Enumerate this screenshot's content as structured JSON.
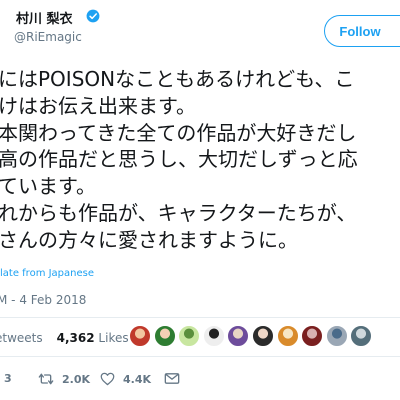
{
  "author": {
    "name": "村川 梨衣",
    "handle": "@RiEmagic",
    "verified": true
  },
  "follow_button": {
    "label": "Follow"
  },
  "tweet": {
    "lines": [
      "にはPOISONなこともあるけれども、こ",
      "けはお伝え出来ます。",
      "本関わってきた全ての作品が大好きだし",
      "高の作品だと思うし、大切だしずっと応",
      "ています。",
      "れからも作品が、キャラクターたちが、",
      "さんの方々に愛されますように。"
    ]
  },
  "translate_link": "late from Japanese",
  "timestamp": "M - 4 Feb 2018",
  "stats": {
    "retweets_label": "etweets",
    "likes_count": "4,362",
    "likes_label": "Likes"
  },
  "liker_avatars": [
    {
      "name": "avatar-1",
      "color": "#c0392b",
      "accent": "#f2c6a0"
    },
    {
      "name": "avatar-2",
      "color": "#2e7d32",
      "accent": "#f5d0b5"
    },
    {
      "name": "avatar-3",
      "color": "#c8e6a0",
      "accent": "#5a8f3c"
    },
    {
      "name": "avatar-4",
      "color": "#eeeeee",
      "accent": "#222222"
    },
    {
      "name": "avatar-5",
      "color": "#6d4c9b",
      "accent": "#e8d5c4"
    },
    {
      "name": "avatar-6",
      "color": "#2b2b2b",
      "accent": "#f0d8c8"
    },
    {
      "name": "avatar-7",
      "color": "#d98b2b",
      "accent": "#f7e6c4"
    },
    {
      "name": "avatar-8",
      "color": "#7a1f1f",
      "accent": "#d8b0b0"
    },
    {
      "name": "avatar-9",
      "color": "#9aa7b5",
      "accent": "#4a6b8a"
    },
    {
      "name": "avatar-10",
      "color": "#546e7a",
      "accent": "#cfd8dc"
    }
  ],
  "actions": {
    "reply_count": "3",
    "retweet_count": "2.0K",
    "like_count": "4.4K"
  },
  "colors": {
    "accent": "#1da1f2",
    "text": "#14171a",
    "muted": "#657786"
  }
}
